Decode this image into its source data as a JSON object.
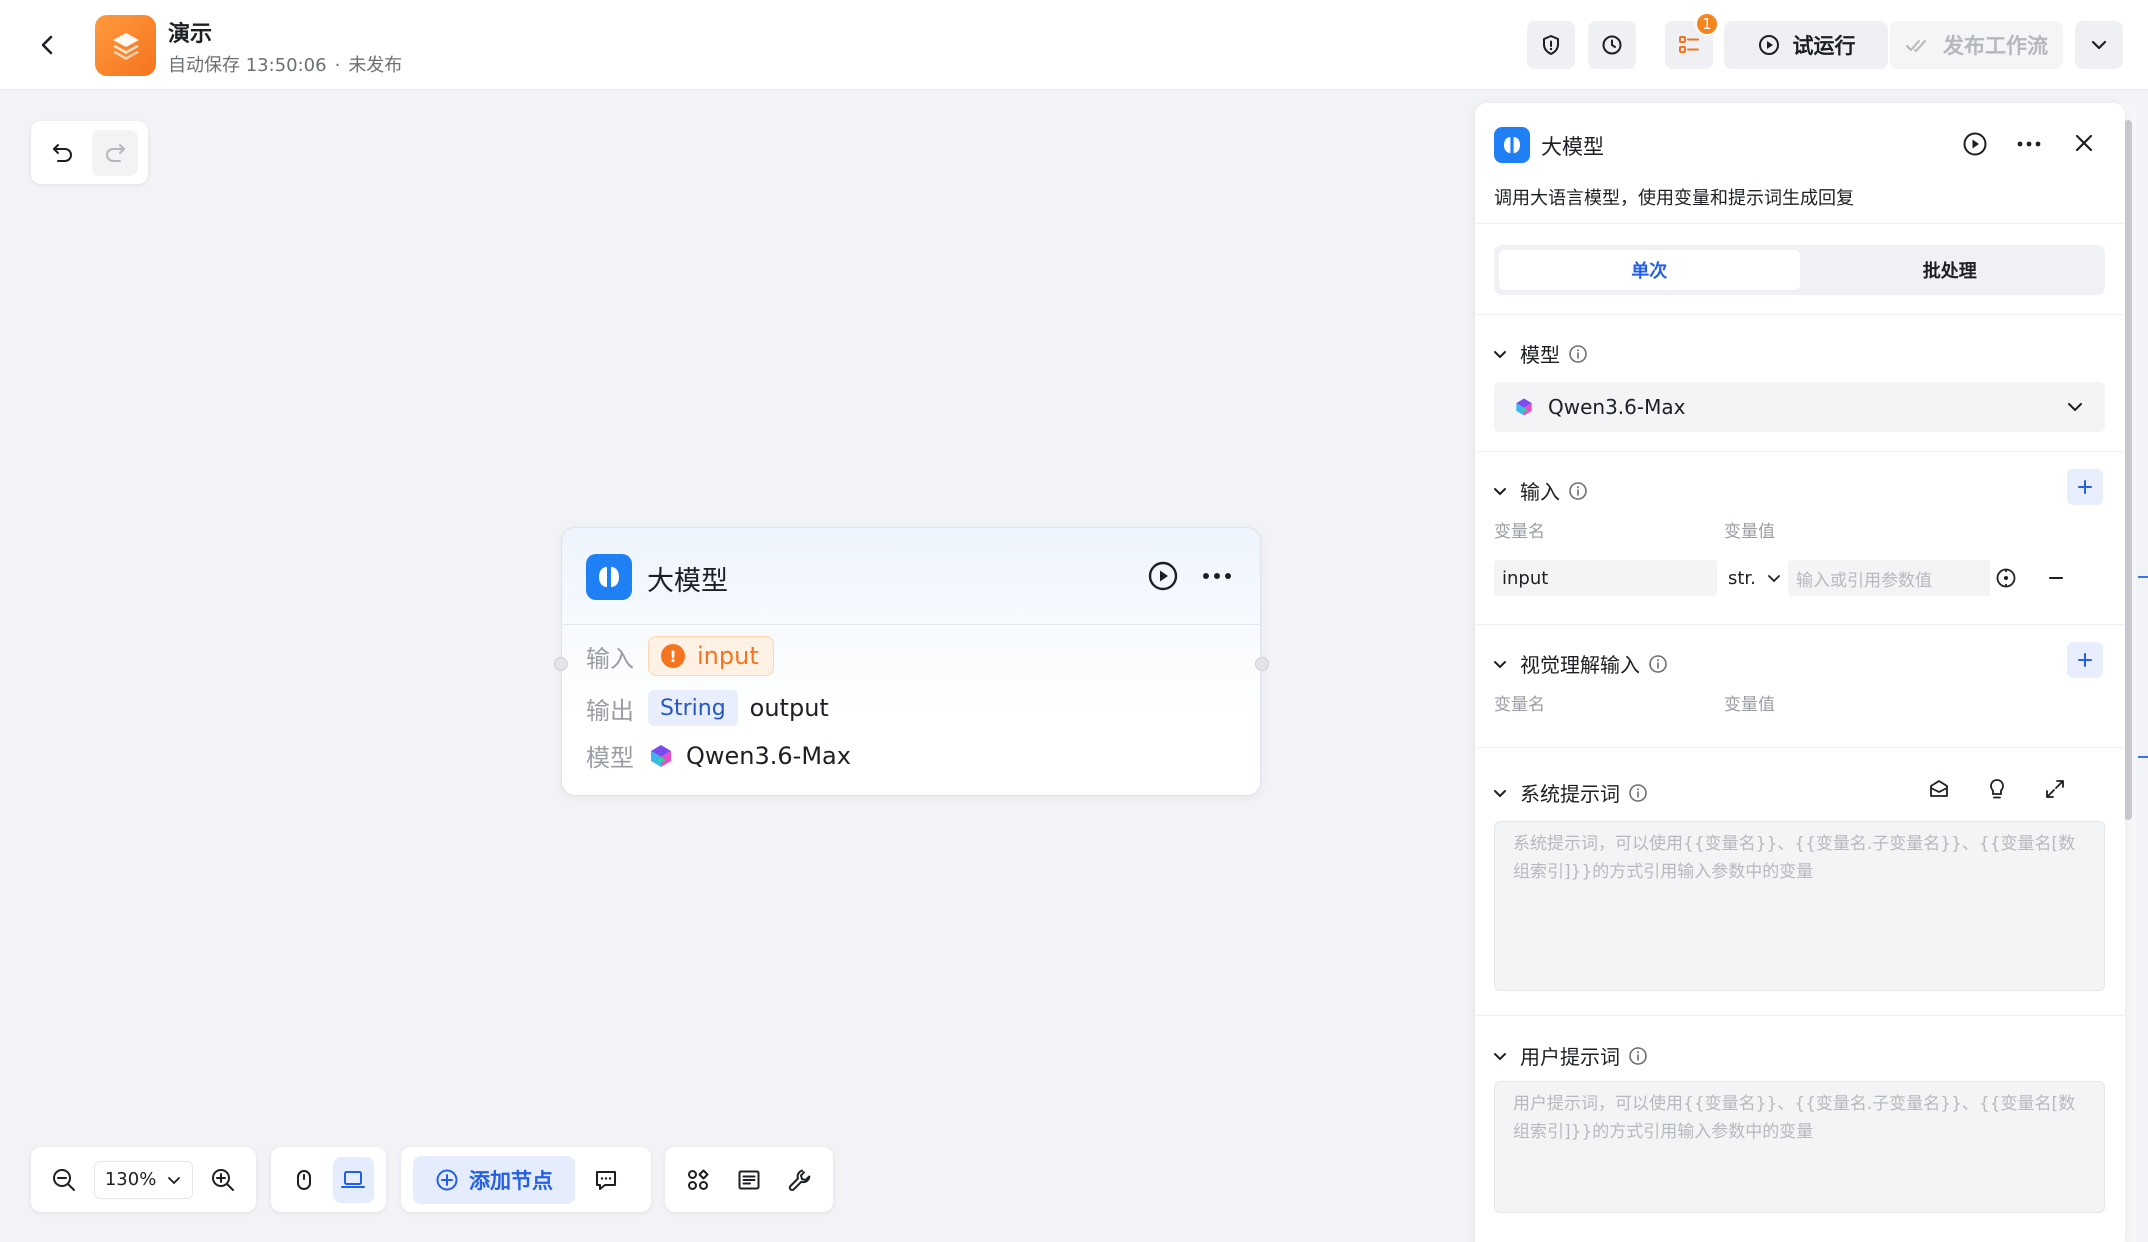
{
  "header": {
    "title": "演示",
    "autosave": "自动保存 13:50:06",
    "separator": "·",
    "status": "未发布",
    "badge_count": "1",
    "test_run_label": "试运行",
    "publish_label": "发布工作流"
  },
  "node": {
    "title": "大模型",
    "input_label": "输入",
    "input_value": "input",
    "output_label": "输出",
    "output_type": "String",
    "output_value": "output",
    "model_label": "模型",
    "model_value": "Qwen3.6-Max"
  },
  "toolbar": {
    "zoom": "130%",
    "add_node_label": "添加节点"
  },
  "panel": {
    "title": "大模型",
    "description": "调用大语言模型，使用变量和提示词生成回复",
    "tabs": [
      {
        "label": "单次",
        "active": true
      },
      {
        "label": "批处理",
        "active": false
      }
    ],
    "model_section": "模型",
    "model_value": "Qwen3.6-Max",
    "input_section": "输入",
    "var_name_col": "变量名",
    "var_value_col": "变量值",
    "input_var_name": "input",
    "input_var_type": "str.",
    "input_var_placeholder": "输入或引用参数值",
    "vision_section": "视觉理解输入",
    "vision_var_name_col": "变量名",
    "vision_var_value_col": "变量值",
    "system_prompt_section": "系统提示词",
    "system_prompt_placeholder": "系统提示词，可以使用{{变量名}}、{{变量名.子变量名}}、{{变量名[数组索引]}}的方式引用输入参数中的变量",
    "user_prompt_section": "用户提示词",
    "user_prompt_placeholder": "用户提示词，可以使用{{变量名}}、{{变量名.子变量名}}、{{变量名[数组索引]}}的方式引用输入参数中的变量"
  },
  "colors": {
    "accent": "#2460e6",
    "warning": "#f5741f",
    "brand_orange": "#f5851f"
  }
}
